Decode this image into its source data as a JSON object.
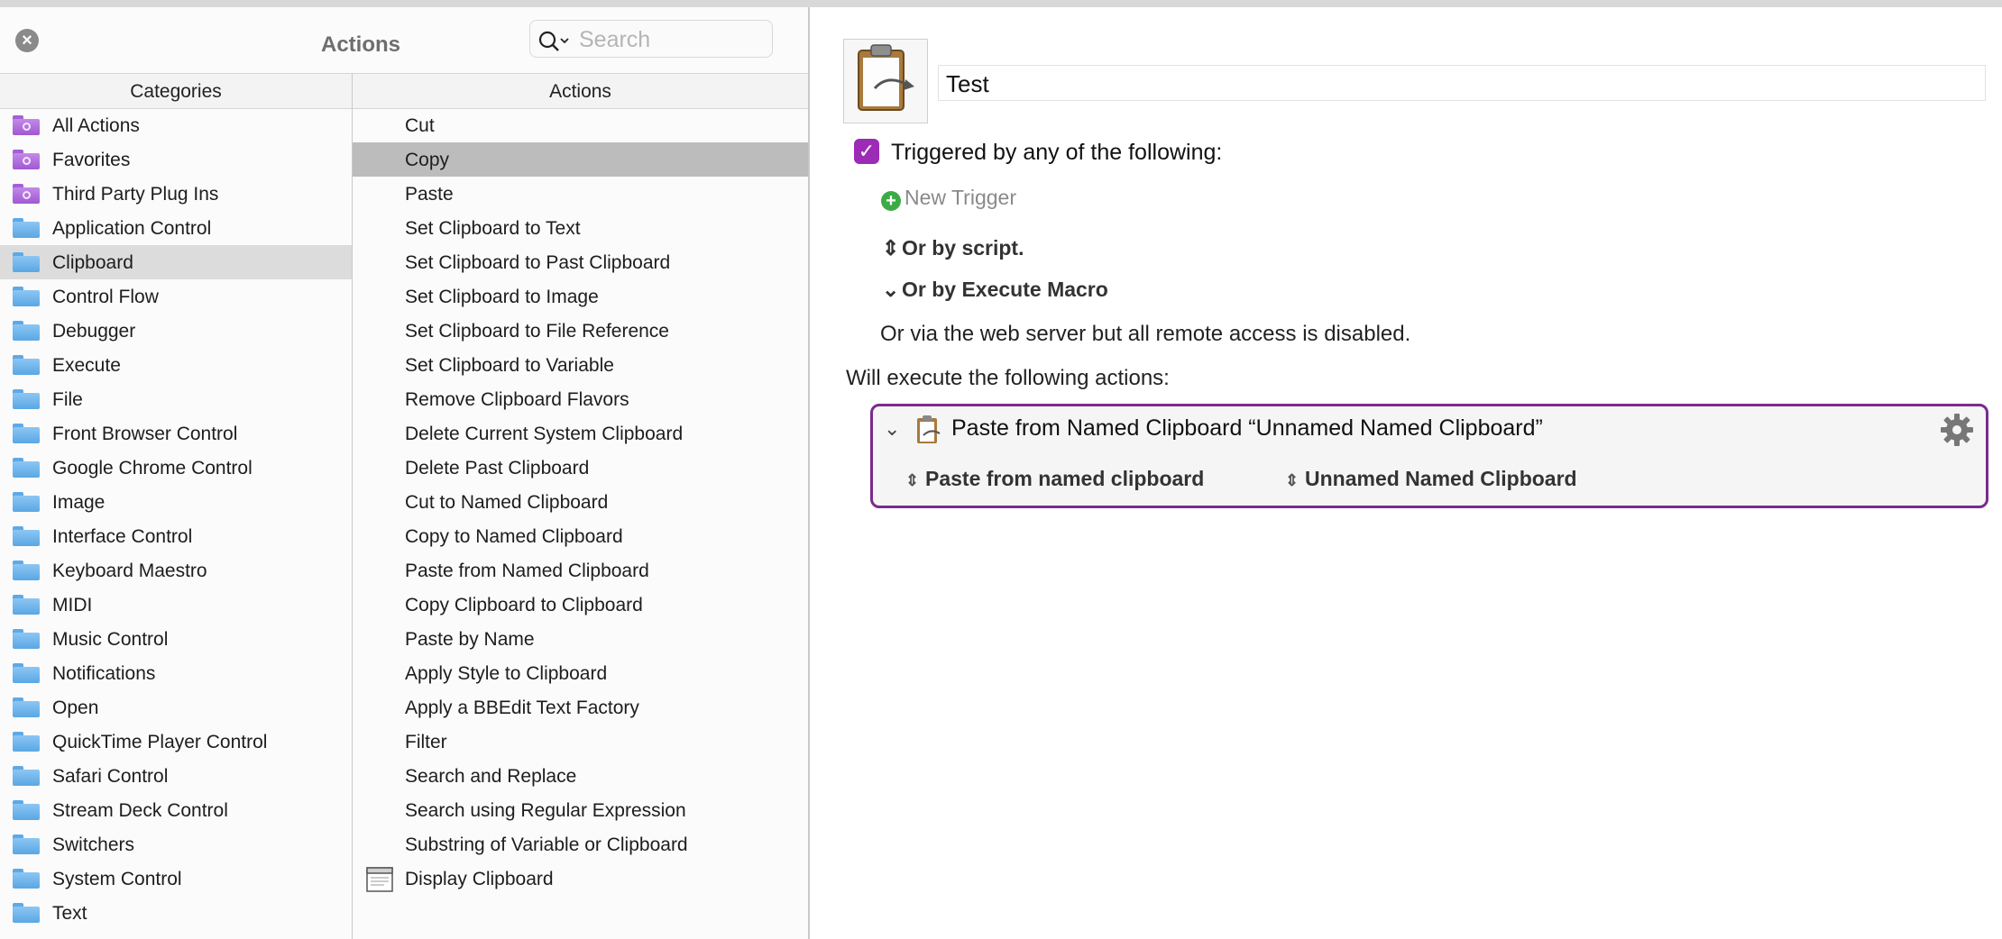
{
  "panel": {
    "title": "Actions",
    "search_placeholder": "Search",
    "categories_header": "Categories",
    "actions_header": "Actions"
  },
  "categories": [
    {
      "label": "All Actions",
      "icon": "purple-gear-folder-icon"
    },
    {
      "label": "Favorites",
      "icon": "purple-gear-folder-icon"
    },
    {
      "label": "Third Party Plug Ins",
      "icon": "purple-gear-folder-icon"
    },
    {
      "label": "Application Control",
      "icon": "folder-icon"
    },
    {
      "label": "Clipboard",
      "icon": "folder-icon",
      "selected": true
    },
    {
      "label": "Control Flow",
      "icon": "folder-icon"
    },
    {
      "label": "Debugger",
      "icon": "folder-icon"
    },
    {
      "label": "Execute",
      "icon": "folder-icon"
    },
    {
      "label": "File",
      "icon": "folder-icon"
    },
    {
      "label": "Front Browser Control",
      "icon": "folder-icon"
    },
    {
      "label": "Google Chrome Control",
      "icon": "folder-icon"
    },
    {
      "label": "Image",
      "icon": "folder-icon"
    },
    {
      "label": "Interface Control",
      "icon": "folder-icon"
    },
    {
      "label": "Keyboard Maestro",
      "icon": "folder-icon"
    },
    {
      "label": "MIDI",
      "icon": "folder-icon"
    },
    {
      "label": "Music Control",
      "icon": "folder-icon"
    },
    {
      "label": "Notifications",
      "icon": "folder-icon"
    },
    {
      "label": "Open",
      "icon": "folder-icon"
    },
    {
      "label": "QuickTime Player Control",
      "icon": "folder-icon"
    },
    {
      "label": "Safari Control",
      "icon": "folder-icon"
    },
    {
      "label": "Stream Deck Control",
      "icon": "folder-icon"
    },
    {
      "label": "Switchers",
      "icon": "folder-icon"
    },
    {
      "label": "System Control",
      "icon": "folder-icon"
    },
    {
      "label": "Text",
      "icon": "folder-icon"
    }
  ],
  "actions": [
    {
      "label": "Cut"
    },
    {
      "label": "Copy",
      "selected": true
    },
    {
      "label": "Paste"
    },
    {
      "label": "Set Clipboard to Text"
    },
    {
      "label": "Set Clipboard to Past Clipboard"
    },
    {
      "label": "Set Clipboard to Image"
    },
    {
      "label": "Set Clipboard to File Reference"
    },
    {
      "label": "Set Clipboard to Variable"
    },
    {
      "label": "Remove Clipboard Flavors"
    },
    {
      "label": "Delete Current System Clipboard"
    },
    {
      "label": "Delete Past Clipboard"
    },
    {
      "label": "Cut to Named Clipboard"
    },
    {
      "label": "Copy to Named Clipboard"
    },
    {
      "label": "Paste from Named Clipboard"
    },
    {
      "label": "Copy Clipboard to Clipboard"
    },
    {
      "label": "Paste by Name"
    },
    {
      "label": "Apply Style to Clipboard"
    },
    {
      "label": "Apply a BBEdit Text Factory"
    },
    {
      "label": "Filter"
    },
    {
      "label": "Search and Replace"
    },
    {
      "label": "Search using Regular Expression"
    },
    {
      "label": "Substring of Variable or Clipboard"
    },
    {
      "label": "Display Clipboard",
      "icon": "window-icon"
    }
  ],
  "editor": {
    "macro_name": "Test",
    "triggered_label": "Triggered by any of the following:",
    "triggered_checked": true,
    "new_trigger_label": "New Trigger",
    "or_by_script": "Or by script.",
    "or_by_execute_macro": "Or by Execute Macro",
    "web_server_text": "Or via the web server but all remote access is disabled.",
    "will_execute_label": "Will execute the following actions:",
    "action": {
      "title": "Paste from Named Clipboard “Unnamed Named Clipboard”",
      "mode_popup": "Paste from named clipboard",
      "clipboard_popup": "Unnamed Named Clipboard"
    }
  },
  "colors": {
    "accent_purple": "#7b2a8c",
    "checkbox": "#9c2bb5",
    "folder_blue": "#5aa7e4",
    "folder_purple": "#9f58d2",
    "plus_green": "#3cab46"
  }
}
